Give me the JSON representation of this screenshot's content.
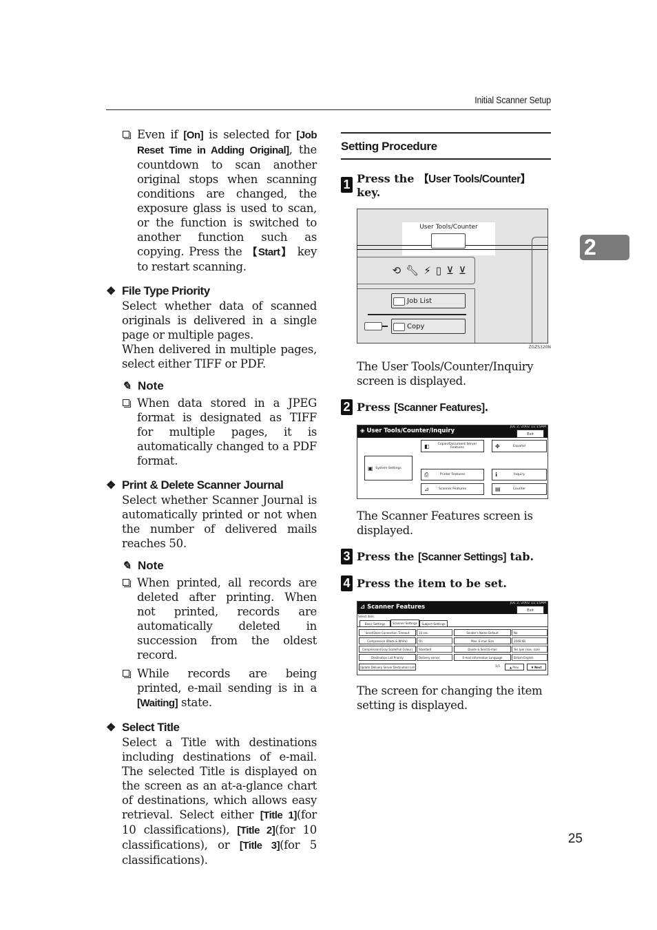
{
  "running_header": "Initial Scanner Setup",
  "chapter_tab": "2",
  "page_number": "25",
  "left_column": {
    "intro_bullet": {
      "parts": [
        "Even if ",
        "[On]",
        " is selected for ",
        "[Job Reset Time in Adding Original]",
        ", the countdown to scan another original stops when scanning conditions are changed, the exposure glass is used to scan, or the function is switched to another function such as copying. Press the ",
        "【Start】",
        " key to restart scanning."
      ]
    },
    "sections": [
      {
        "heading": "File Type Priority",
        "body": [
          "Select whether data of scanned originals is delivered in a single page or multiple pages.",
          "When delivered in multiple pages, select either TIFF or PDF."
        ],
        "note_label": "Note",
        "notes": [
          {
            "parts": [
              "When data stored in a JPEG format is designated as TIFF for multiple pages, it is automatically changed to a PDF format."
            ]
          }
        ]
      },
      {
        "heading": "Print & Delete Scanner Journal",
        "body": [
          "Select whether Scanner Journal is automatically printed or not when the number of delivered mails reaches 50."
        ],
        "note_label": "Note",
        "notes": [
          {
            "parts": [
              "When printed, all records are deleted after printing. When not printed, records are automatically deleted in succession from the oldest record."
            ]
          },
          {
            "parts": [
              "While records are being printed, e-mail sending is in a ",
              "[Waiting]",
              " state."
            ]
          }
        ]
      },
      {
        "heading": "Select Title",
        "body_parts": [
          "Select a Title with destinations including destinations of e-mail. The selected Title is displayed on the screen as an at-a-glance chart of destinations, which allows easy retrieval. Select either ",
          "[Title 1]",
          "(for 10 classifications), ",
          "[Title 2]",
          "(for 10 classifications), or ",
          "[Title 3]",
          "(for 5 classifications)."
        ]
      }
    ]
  },
  "right_column": {
    "heading": "Setting Procedure",
    "steps": [
      {
        "num": "1",
        "pre": "Press the ",
        "kw": "【User Tools/Counter】",
        "post": " key.",
        "caption": "The User Tools/Counter/Inquiry screen is displayed."
      },
      {
        "num": "2",
        "pre": "Press ",
        "kw": "[Scanner Features]",
        "post": ".",
        "caption": "The Scanner Features screen is displayed."
      },
      {
        "num": "3",
        "pre": "Press the ",
        "kw": "[Scanner Settings]",
        "post": " tab.",
        "caption": ""
      },
      {
        "num": "4",
        "pre": "Press the item to be set.",
        "kw": "",
        "post": "",
        "caption": "The screen for changing the item setting is displayed."
      }
    ],
    "figure1": {
      "key_label": "User Tools/Counter",
      "icons": [
        "login-icon",
        "wrench-icon",
        "energy-saver-icon",
        "interrupt-icon",
        "tray-icon",
        "tray-alt-icon"
      ],
      "buttons": [
        "Job List",
        "Copy"
      ],
      "code": "ZGZS320N"
    },
    "figure2": {
      "title": "User Tools/Counter/Inquiry",
      "date": "JUL   2, 2002 11:15AM",
      "exit": "Exit",
      "buttons": {
        "system_settings": "System Settings",
        "copier": "Copier/Document Server Features",
        "language": "Español",
        "printer": "Printer Features",
        "inquiry": "Inquiry",
        "scanner": "Scanner Features",
        "counter": "Counter"
      }
    },
    "figure3": {
      "title": "Scanner Features",
      "date": "JUL   2, 2002 11:15AM",
      "exit": "Exit",
      "select_item": "Select item.",
      "tabs": [
        "Basic Settings",
        "Scanner Settings",
        "Subject Settings"
      ],
      "active_tab": 1,
      "rows": [
        {
          "l_label": "Send/Store Connection Timeout",
          "l_value": "10 sec.",
          "r_label": "Sender's Name Default",
          "r_value": "No"
        },
        {
          "l_label": "Compression (Black & White)",
          "l_value": "On",
          "r_label": "Max. E-mail Size",
          "r_value": "2048 KB"
        },
        {
          "l_label": "Compression(Gray Scale/Full Colour)",
          "l_value": "Standard",
          "r_label": "Divide & Send E-mail",
          "r_value": "Yes (per max. size)"
        },
        {
          "l_label": "Destination List Priority",
          "l_value": "Delivery server",
          "r_label": "E-mail Information Language",
          "r_value": "British English"
        }
      ],
      "last_button": "Update Delivery Server Destination List",
      "pager": "1/1",
      "prev": "▲ Prev.",
      "next": "▼ Next"
    }
  }
}
